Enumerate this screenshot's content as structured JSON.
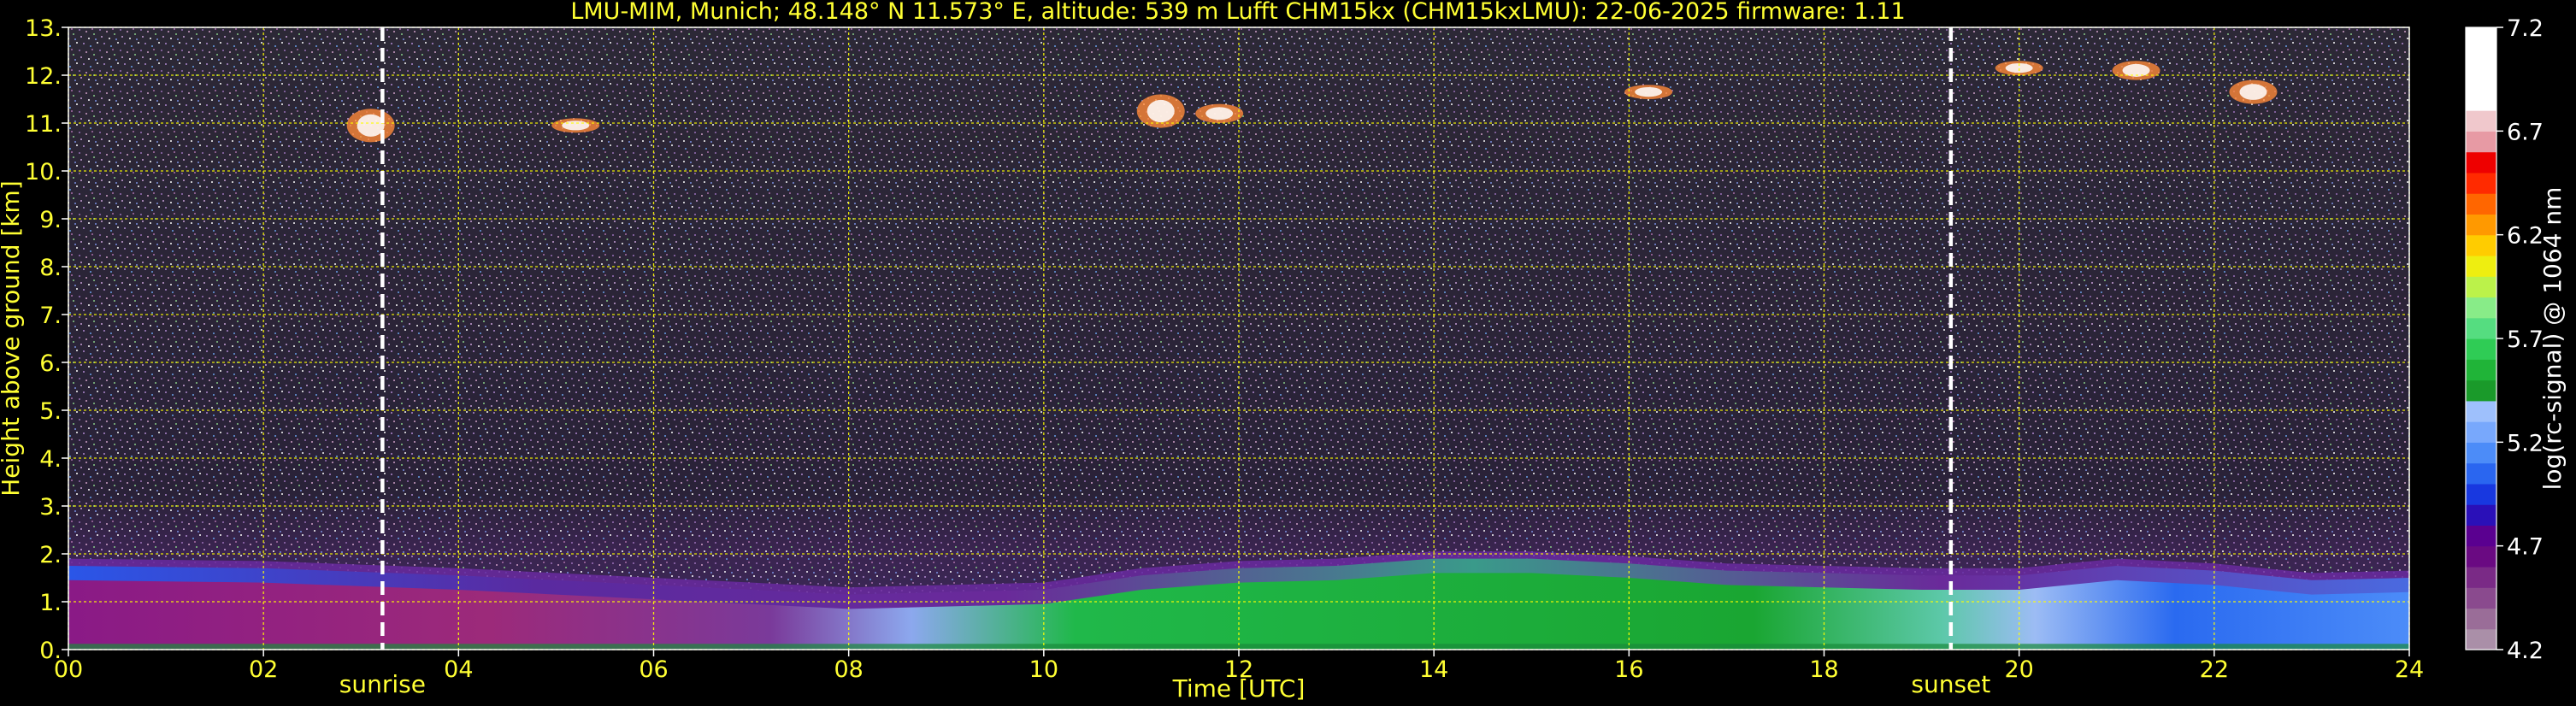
{
  "chart_data": {
    "type": "heatmap",
    "title": "LMU-MIM, Munich; 48.148° N 11.573° E, altitude: 539 m    Lufft CHM15kx (CHM15kxLMU): 22-06-2025    firmware: 1.11",
    "xlabel": "Time [UTC]",
    "ylabel": "Height above ground [km]",
    "xlim": [
      0,
      24
    ],
    "ylim": [
      0,
      13
    ],
    "x_ticks": [
      0,
      2,
      4,
      6,
      8,
      10,
      12,
      14,
      16,
      18,
      20,
      22,
      24
    ],
    "x_tick_labels": [
      "00",
      "02",
      "04",
      "06",
      "08",
      "10",
      "12",
      "14",
      "16",
      "18",
      "20",
      "22",
      "24"
    ],
    "y_ticks": [
      0,
      1,
      2,
      3,
      4,
      5,
      6,
      7,
      8,
      9,
      10,
      11,
      12,
      13
    ],
    "y_tick_labels": [
      "0.",
      "1.",
      "2.",
      "3.",
      "4.",
      "5.",
      "6.",
      "7.",
      "8.",
      "9.",
      "10.",
      "11.",
      "12.",
      "13."
    ],
    "grid": true,
    "grid_color": "#ffff00",
    "background": "#000000",
    "colorbar": {
      "label": "log(rc-signal) @ 1064 nm",
      "range": [
        4.2,
        7.2
      ],
      "ticks": [
        4.2,
        4.7,
        5.2,
        5.7,
        6.2,
        6.7,
        7.2
      ],
      "tick_labels": [
        "4.2",
        "4.7",
        "5.2",
        "5.7",
        "6.2",
        "6.7",
        "7.2"
      ],
      "colors": [
        "#aa8fa8",
        "#9a6d98",
        "#8a4a8e",
        "#7a2a86",
        "#6a0a82",
        "#5a0090",
        "#2a10b8",
        "#1838e0",
        "#2a66f0",
        "#4c8cf8",
        "#78a8fc",
        "#9ec0fc",
        "#1a9a2a",
        "#20b438",
        "#2fcc55",
        "#55dd80",
        "#88ec88",
        "#bbf24a",
        "#eeee10",
        "#ffcc00",
        "#ff9900",
        "#ff6600",
        "#ff2a00",
        "#ee0000",
        "#e79aa4",
        "#f0c8cc",
        "#ffffff",
        "#ffffff",
        "#ffffff",
        "#ffffff"
      ]
    },
    "annotations": [
      {
        "label": "sunrise",
        "time": 3.22,
        "line_style": "dashed",
        "color": "#ffffff"
      },
      {
        "label": "sunset",
        "time": 19.3,
        "line_style": "dashed",
        "color": "#ffffff"
      }
    ],
    "layers": [
      {
        "name": "noise",
        "bottom_km": 2.5,
        "top_km": 13
      },
      {
        "name": "boundary",
        "times": [
          0,
          2,
          4,
          6,
          8,
          10,
          11,
          12,
          13,
          14,
          15,
          16,
          17,
          18,
          19,
          20,
          21,
          22,
          23,
          24
        ],
        "tops_km": [
          1.9,
          1.85,
          1.7,
          1.5,
          1.3,
          1.4,
          1.7,
          1.85,
          1.9,
          2.05,
          2.05,
          1.95,
          1.8,
          1.75,
          1.7,
          1.7,
          1.9,
          1.8,
          1.6,
          1.65
        ]
      },
      {
        "name": "cirrus",
        "segments": [
          [
            3.1,
            10.6,
            11.3
          ],
          [
            5.2,
            10.8,
            11.1
          ],
          [
            11.2,
            10.9,
            11.6
          ],
          [
            11.8,
            11.0,
            11.4
          ],
          [
            16.2,
            11.5,
            11.8
          ],
          [
            20.0,
            12.0,
            12.3
          ],
          [
            21.2,
            11.9,
            12.3
          ],
          [
            22.4,
            11.4,
            11.9
          ]
        ]
      }
    ]
  }
}
